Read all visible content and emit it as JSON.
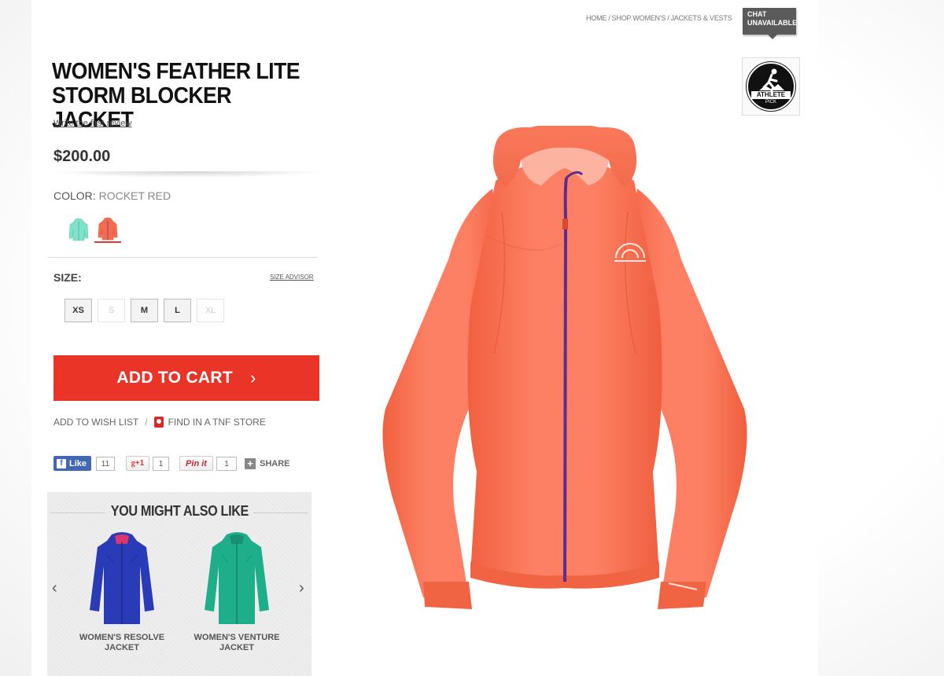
{
  "breadcrumb": [
    {
      "label": "HOME"
    },
    {
      "label": "SHOP WOMEN'S"
    },
    {
      "label": "JACKETS & VESTS"
    }
  ],
  "chat": {
    "line1": "CHAT",
    "line2": "UNAVAILABLE"
  },
  "athlete_pick": {
    "line1": "ATHLETE",
    "line2": "PICK"
  },
  "product": {
    "title_line1": "WOMEN'S FEATHER LITE",
    "title_line2": "STORM BLOCKER JACKET",
    "review_link": "Write the first review",
    "price": "$200.00"
  },
  "color": {
    "label": "COLOR:",
    "selected": "ROCKET RED",
    "swatches": [
      {
        "name": "mint",
        "color": "#7fe3c9"
      },
      {
        "name": "rocket-red",
        "color": "#f56b4f"
      }
    ]
  },
  "size": {
    "label": "SIZE:",
    "advisor": "SIZE ADVISOR",
    "options": [
      {
        "label": "XS",
        "available": true
      },
      {
        "label": "S",
        "available": false
      },
      {
        "label": "M",
        "available": true
      },
      {
        "label": "L",
        "available": true
      },
      {
        "label": "XL",
        "available": false
      }
    ]
  },
  "cart": {
    "label": "ADD TO CART",
    "chevron": "›"
  },
  "actions": {
    "wish_list": "ADD TO WISH LIST",
    "separator": "/",
    "find_store": "FIND IN A TNF STORE"
  },
  "social": {
    "fb_label": "Like",
    "fb_count": "11",
    "gplus_label": "+1",
    "gplus_count": "1",
    "pin_label": "Pin it",
    "pin_count": "1",
    "share_label": "SHARE"
  },
  "recommendations": {
    "title": "YOU MIGHT ALSO LIKE",
    "items": [
      {
        "line1": "WOMEN'S RESOLVE",
        "line2": "JACKET",
        "color": "#2a3bb8"
      },
      {
        "line1": "WOMEN'S VENTURE",
        "line2": "JACKET",
        "color": "#1fae8a"
      }
    ]
  },
  "colors": {
    "accent": "#ea3427",
    "jacket_main": "#fb7a5c",
    "zipper": "#5b2d8e"
  }
}
